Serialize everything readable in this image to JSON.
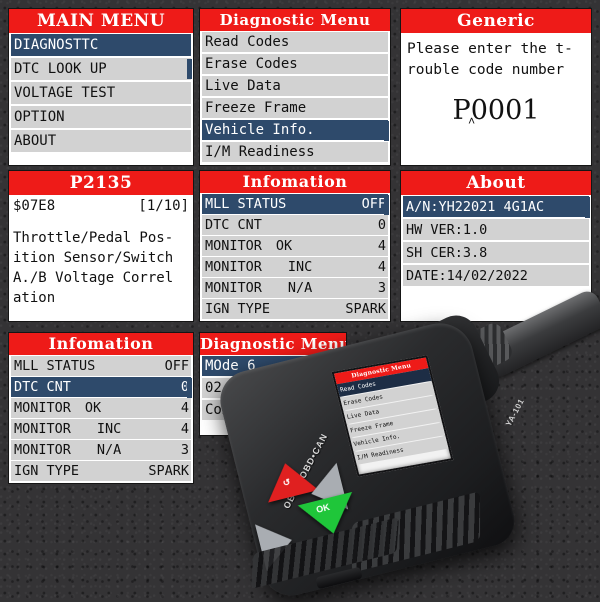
{
  "background": {
    "color": "#343335"
  },
  "theme": {
    "title_bar": "#ee1b18",
    "row": "#d2d2d2",
    "row_selected": "#2e4a6b",
    "screen": "#ffffff"
  },
  "panels": {
    "main_menu": {
      "title": "MAIN MENU",
      "items": [
        {
          "label": "DIAGNOSTTC",
          "selected": true
        },
        {
          "label": "DTC LOOK UP",
          "selected": false
        },
        {
          "label": "VOLTAGE TEST",
          "selected": false
        },
        {
          "label": "OPTION",
          "selected": false
        },
        {
          "label": "ABOUT",
          "selected": false
        }
      ]
    },
    "diagnostic_menu": {
      "title": "Diagnostic Menu",
      "items": [
        {
          "label": "Read Codes",
          "selected": false
        },
        {
          "label": "Erase Codes",
          "selected": false
        },
        {
          "label": "Live Data",
          "selected": false
        },
        {
          "label": "Freeze Frame",
          "selected": false
        },
        {
          "label": "Vehicle Info.",
          "selected": true
        },
        {
          "label": "I/M Readiness",
          "selected": false
        }
      ]
    },
    "generic": {
      "title": "Generic",
      "prompt_line1": "Please enter the t-",
      "prompt_line2": "rouble code number",
      "code_value": "P0001",
      "cursor_glyph": "˄"
    },
    "dtc_detail": {
      "title": "P2135",
      "module": "$07E8",
      "counter": "[1/10]",
      "description_lines": [
        "Throttle/Pedal Pos-",
        "ition Sensor/Switch",
        "A./B Voltage Correl",
        "ation"
      ]
    },
    "information_top": {
      "title": "Infomation",
      "rows": [
        {
          "label": "MLL STATUS",
          "mid": "",
          "value": "OFF",
          "selected": true
        },
        {
          "label": "DTC CNT",
          "mid": "",
          "value": "0",
          "selected": false
        },
        {
          "label": "MONITOR",
          "mid": "OK",
          "value": "4",
          "selected": false
        },
        {
          "label": "MONITOR",
          "mid": "INC",
          "value": "4",
          "selected": false
        },
        {
          "label": "MONITOR",
          "mid": "N/A",
          "value": "3",
          "selected": false
        },
        {
          "label": "IGN TYPE",
          "mid": "",
          "value": "SPARK",
          "selected": false
        }
      ]
    },
    "about": {
      "title": "About",
      "rows": [
        {
          "label": "A/N:YH22021 4G1AC",
          "selected": true
        },
        {
          "label": "HW VER:1.0",
          "selected": false
        },
        {
          "label": "SH CER:3.8",
          "selected": false
        },
        {
          "label": "DATE:14/02/2022",
          "selected": false
        }
      ]
    },
    "information_bottom": {
      "title": "Infomation",
      "rows": [
        {
          "label": "MLL STATUS",
          "mid": "",
          "value": "OFF",
          "selected": false
        },
        {
          "label": "DTC CNT",
          "mid": "",
          "value": "0",
          "selected": true
        },
        {
          "label": "MONITOR",
          "mid": "OK",
          "value": "4",
          "selected": false
        },
        {
          "label": "MONITOR",
          "mid": "INC",
          "value": "4",
          "selected": false
        },
        {
          "label": "MONITOR",
          "mid": "N/A",
          "value": "3",
          "selected": false
        },
        {
          "label": "IGN TYPE",
          "mid": "",
          "value": "SPARK",
          "selected": false
        }
      ]
    },
    "diagnostic_menu_2": {
      "title": "Diagnostic Menu",
      "items": [
        {
          "label": "MOde 6",
          "selected": true
        },
        {
          "label": "02 Sensor Test",
          "selected": false
        },
        {
          "label": "Component Test",
          "selected": false
        }
      ]
    }
  },
  "device": {
    "brand_text": "OBDII•OBD•CAN",
    "model_text": "YA-101",
    "screen": {
      "title": "Diagnostic Menu",
      "items": [
        {
          "label": "Read Codes",
          "selected": true
        },
        {
          "label": "Erase Codes",
          "selected": false
        },
        {
          "label": "Live Data",
          "selected": false
        },
        {
          "label": "Freeze Frame",
          "selected": false
        },
        {
          "label": "Vehicle Info.",
          "selected": false
        },
        {
          "label": "I/M Readiness",
          "selected": false
        }
      ]
    },
    "keys": {
      "back_label": "↺",
      "ok_label": "OK",
      "up_label": "",
      "left_label": ""
    }
  }
}
